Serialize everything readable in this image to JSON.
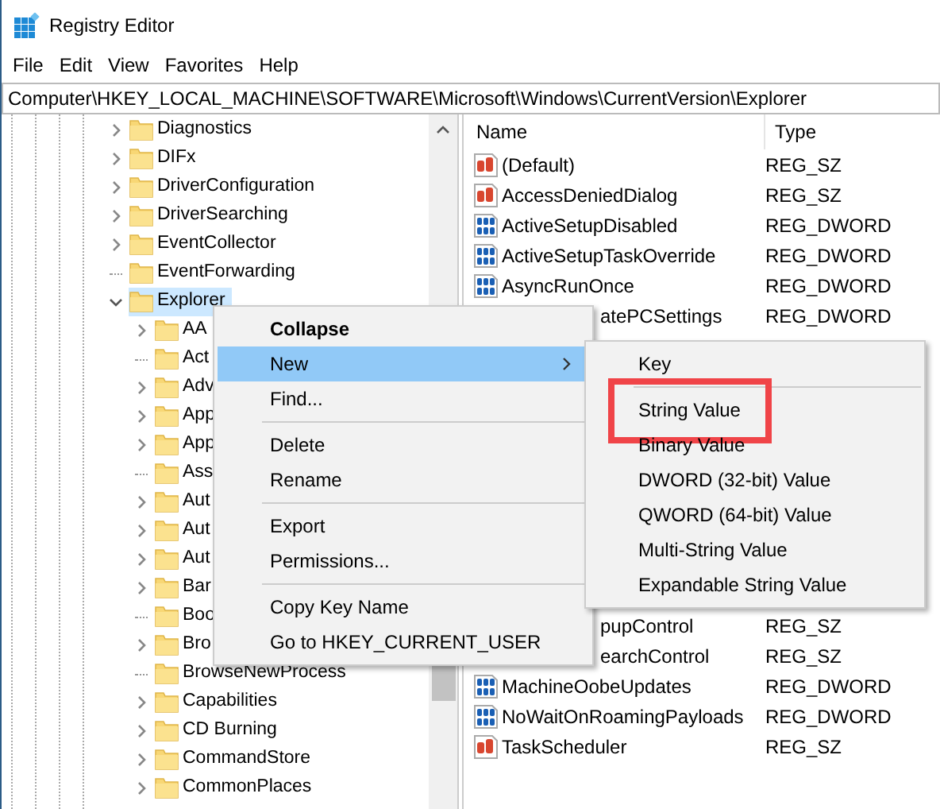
{
  "window": {
    "title": "Registry Editor"
  },
  "menu_bar": [
    "File",
    "Edit",
    "View",
    "Favorites",
    "Help"
  ],
  "address": "Computer\\HKEY_LOCAL_MACHINE\\SOFTWARE\\Microsoft\\Windows\\CurrentVersion\\Explorer",
  "tree": [
    {
      "label": "Diagnostics",
      "has_children": true,
      "expanded": false,
      "selected": false
    },
    {
      "label": "DIFx",
      "has_children": true,
      "expanded": false,
      "selected": false
    },
    {
      "label": "DriverConfiguration",
      "has_children": true,
      "expanded": false,
      "selected": false
    },
    {
      "label": "DriverSearching",
      "has_children": true,
      "expanded": false,
      "selected": false
    },
    {
      "label": "EventCollector",
      "has_children": true,
      "expanded": false,
      "selected": false
    },
    {
      "label": "EventForwarding",
      "has_children": false,
      "selected": false
    },
    {
      "label": "Explorer",
      "has_children": true,
      "expanded": true,
      "selected": true,
      "children": [
        {
          "label": "AA",
          "has_children": true,
          "expanded": false,
          "selected": false
        },
        {
          "label": "Act",
          "has_children": false,
          "selected": false
        },
        {
          "label": "Adv",
          "has_children": true,
          "expanded": false,
          "selected": false
        },
        {
          "label": "App",
          "has_children": true,
          "expanded": false,
          "selected": false
        },
        {
          "label": "App",
          "has_children": true,
          "expanded": false,
          "selected": false
        },
        {
          "label": "Ass",
          "has_children": false,
          "selected": false
        },
        {
          "label": "Aut",
          "has_children": true,
          "expanded": false,
          "selected": false
        },
        {
          "label": "Aut",
          "has_children": true,
          "expanded": false,
          "selected": false
        },
        {
          "label": "Aut",
          "has_children": true,
          "expanded": false,
          "selected": false
        },
        {
          "label": "Bar",
          "has_children": true,
          "expanded": false,
          "selected": false
        },
        {
          "label": "Boo",
          "has_children": false,
          "selected": false
        },
        {
          "label": "Bro",
          "has_children": true,
          "expanded": false,
          "selected": false
        },
        {
          "label": "BrowseNewProcess",
          "has_children": false,
          "selected": false
        },
        {
          "label": "Capabilities",
          "has_children": true,
          "expanded": false,
          "selected": false
        },
        {
          "label": "CD Burning",
          "has_children": true,
          "expanded": false,
          "selected": false
        },
        {
          "label": "CommandStore",
          "has_children": true,
          "expanded": false,
          "selected": false
        },
        {
          "label": "CommonPlaces",
          "has_children": true,
          "expanded": false,
          "selected": false
        }
      ]
    }
  ],
  "values": {
    "columns": [
      "Name",
      "Type"
    ],
    "rows_above": [
      {
        "kind": "string",
        "name": "(Default)",
        "type": "REG_SZ"
      },
      {
        "kind": "string",
        "name": "AccessDeniedDialog",
        "type": "REG_SZ"
      },
      {
        "kind": "dword",
        "name": "ActiveSetupDisabled",
        "type": "REG_DWORD"
      },
      {
        "kind": "dword",
        "name": "ActiveSetupTaskOverride",
        "type": "REG_DWORD"
      },
      {
        "kind": "dword",
        "name": "AsyncRunOnce",
        "type": "REG_DWORD"
      },
      {
        "kind": "covered",
        "name": "atePCSettings",
        "type": "REG_DWORD"
      }
    ],
    "rows_below": [
      {
        "kind": "covered",
        "name": "pupControl",
        "type": "REG_SZ"
      },
      {
        "kind": "covered",
        "name": "earchControl",
        "type": "REG_SZ"
      },
      {
        "kind": "dword",
        "name": "MachineOobeUpdates",
        "type": "REG_DWORD"
      },
      {
        "kind": "dword",
        "name": "NoWaitOnRoamingPayloads",
        "type": "REG_DWORD"
      },
      {
        "kind": "string",
        "name": "TaskScheduler",
        "type": "REG_SZ"
      }
    ]
  },
  "context_menu": [
    {
      "kind": "item",
      "label": "Collapse",
      "bold": true,
      "selected": false,
      "submenu": false
    },
    {
      "kind": "item",
      "label": "New",
      "bold": false,
      "selected": true,
      "submenu": true
    },
    {
      "kind": "item",
      "label": "Find...",
      "bold": false,
      "selected": false,
      "submenu": false
    },
    {
      "kind": "separator"
    },
    {
      "kind": "item",
      "label": "Delete",
      "bold": false,
      "selected": false,
      "submenu": false
    },
    {
      "kind": "item",
      "label": "Rename",
      "bold": false,
      "selected": false,
      "submenu": false
    },
    {
      "kind": "separator"
    },
    {
      "kind": "item",
      "label": "Export",
      "bold": false,
      "selected": false,
      "submenu": false
    },
    {
      "kind": "item",
      "label": "Permissions...",
      "bold": false,
      "selected": false,
      "submenu": false
    },
    {
      "kind": "separator"
    },
    {
      "kind": "item",
      "label": "Copy Key Name",
      "bold": false,
      "selected": false,
      "submenu": false
    },
    {
      "kind": "item",
      "label": "Go to HKEY_CURRENT_USER",
      "bold": false,
      "selected": false,
      "submenu": false
    }
  ],
  "submenu": [
    {
      "kind": "item",
      "label": "Key",
      "highlighted": false
    },
    {
      "kind": "separator"
    },
    {
      "kind": "item",
      "label": "String Value",
      "highlighted": true
    },
    {
      "kind": "item",
      "label": "Binary Value",
      "highlighted": false
    },
    {
      "kind": "item",
      "label": "DWORD (32-bit) Value",
      "highlighted": false
    },
    {
      "kind": "item",
      "label": "QWORD (64-bit) Value",
      "highlighted": false
    },
    {
      "kind": "item",
      "label": "Multi-String Value",
      "highlighted": false
    },
    {
      "kind": "item",
      "label": "Expandable String Value",
      "highlighted": false
    }
  ]
}
